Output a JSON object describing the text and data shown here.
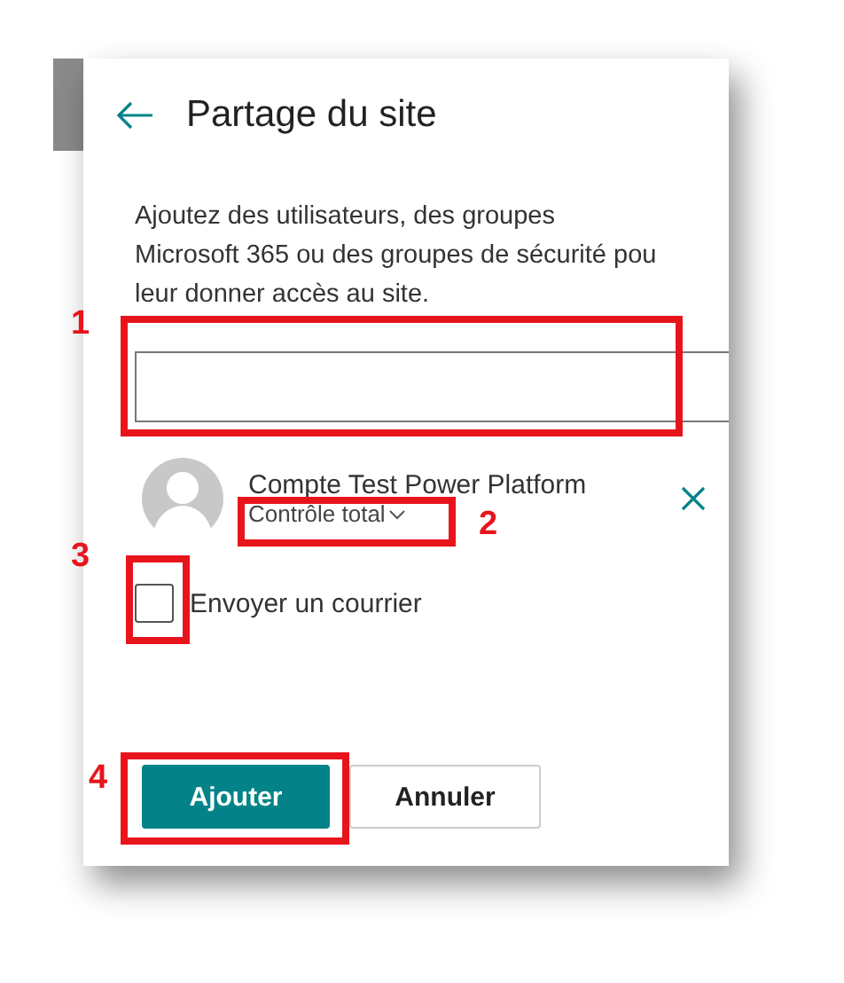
{
  "panel": {
    "title": "Partage du site",
    "description_lines": [
      "Ajoutez des utilisateurs, des groupes",
      "Microsoft 365 ou des groupes de sécurité pou",
      "leur donner accès au site."
    ]
  },
  "member": {
    "name": "Compte Test Power Platform",
    "permission": "Contrôle total"
  },
  "checkbox": {
    "label": "Envoyer un courrier",
    "checked": false
  },
  "buttons": [
    {
      "label": "Ajouter",
      "kind": "primary"
    },
    {
      "label": "Annuler",
      "kind": "secondary"
    }
  ],
  "annotations": [
    {
      "number": "1"
    },
    {
      "number": "2"
    },
    {
      "number": "3"
    },
    {
      "number": "4"
    }
  ]
}
